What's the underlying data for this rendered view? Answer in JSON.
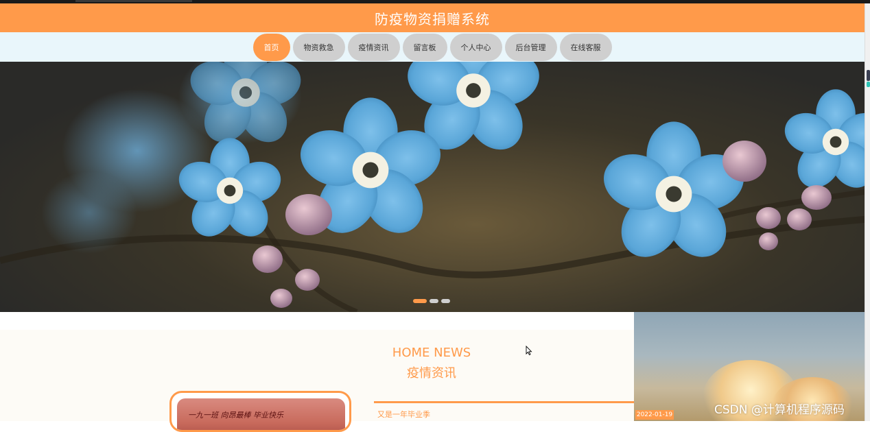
{
  "header": {
    "title": "防疫物资捐赠系统"
  },
  "nav": {
    "items": [
      {
        "label": "首页",
        "active": true
      },
      {
        "label": "物资救急"
      },
      {
        "label": "疫情资讯"
      },
      {
        "label": "留言板"
      },
      {
        "label": "个人中心"
      },
      {
        "label": "后台管理"
      },
      {
        "label": "在线客服"
      }
    ]
  },
  "banner": {
    "image": "blue forget-me-not flowers photo",
    "slide_count": 3,
    "active_slide": 1
  },
  "news": {
    "heading_en": "HOME NEWS",
    "heading_cn": "疫情资讯",
    "items": [
      {
        "title": "又是一年毕业季",
        "date": "2022-01-19"
      }
    ],
    "card_caption": "一九一班 向昂最棒 毕业快乐"
  },
  "watermark": "CSDN @计算机程序源码",
  "colors": {
    "accent": "#ff9a4a",
    "nav_bg": "#e9f6fb",
    "pill": "#cfcfcf"
  }
}
